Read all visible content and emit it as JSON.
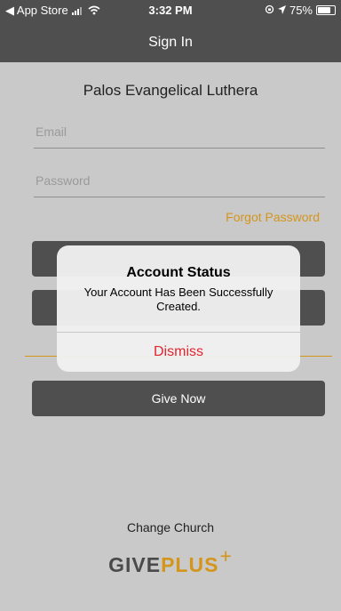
{
  "status_bar": {
    "back_app": "◀ App Store",
    "time": "3:32 PM",
    "battery": "75%"
  },
  "nav": {
    "title": "Sign In"
  },
  "church_name": "Palos Evangelical Luthera",
  "form": {
    "email_placeholder": "Email",
    "password_placeholder": "Password",
    "forgot_password": "Forgot Password"
  },
  "buttons": {
    "give_now": "Give Now"
  },
  "alert": {
    "title": "Account Status",
    "message": "Your Account Has Been Successfully Created.",
    "dismiss": "Dismiss"
  },
  "footer": {
    "change_church": "Change Church",
    "logo_give": "GIVE",
    "logo_plus": "PLUS",
    "logo_cross": "+"
  },
  "colors": {
    "accent": "#d4951b",
    "bar": "#4f4f4f",
    "background": "#c9c9c9",
    "dismiss": "#e0262e"
  }
}
